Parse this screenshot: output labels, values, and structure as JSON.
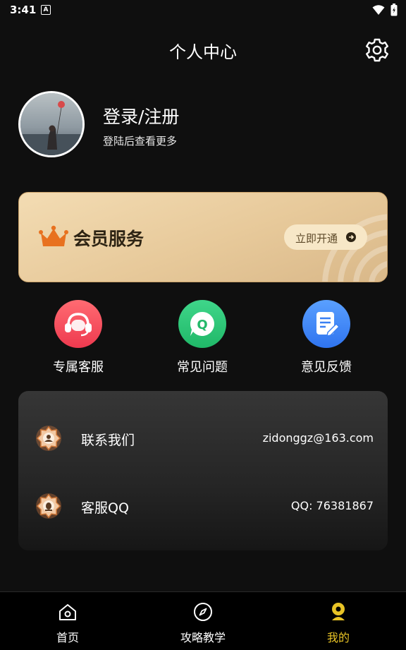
{
  "status": {
    "time": "3:41",
    "a_icon": "A"
  },
  "header": {
    "title": "个人中心"
  },
  "profile": {
    "title": "登录/注册",
    "subtitle": "登陆后查看更多"
  },
  "member": {
    "title": "会员服务",
    "button_label": "立即开通"
  },
  "shortcuts": [
    {
      "label": "专属客服",
      "icon": "headset-icon",
      "color": "#f34a5a"
    },
    {
      "label": "常见问题",
      "icon": "faq-icon",
      "color": "#2fc87a"
    },
    {
      "label": "意见反馈",
      "icon": "feedback-icon",
      "color": "#3e86f5"
    }
  ],
  "contact": {
    "rows": [
      {
        "label": "联系我们",
        "value": "zidonggz@163.com",
        "icon": "contact-icon"
      },
      {
        "label": "客服QQ",
        "value": "QQ: 76381867",
        "icon": "qq-icon"
      }
    ]
  },
  "nav": {
    "items": [
      {
        "label": "首页",
        "icon": "home-icon"
      },
      {
        "label": "攻略教学",
        "icon": "compass-icon"
      },
      {
        "label": "我的",
        "icon": "profile-icon",
        "active": true
      }
    ],
    "active_color": "#e8c326"
  }
}
